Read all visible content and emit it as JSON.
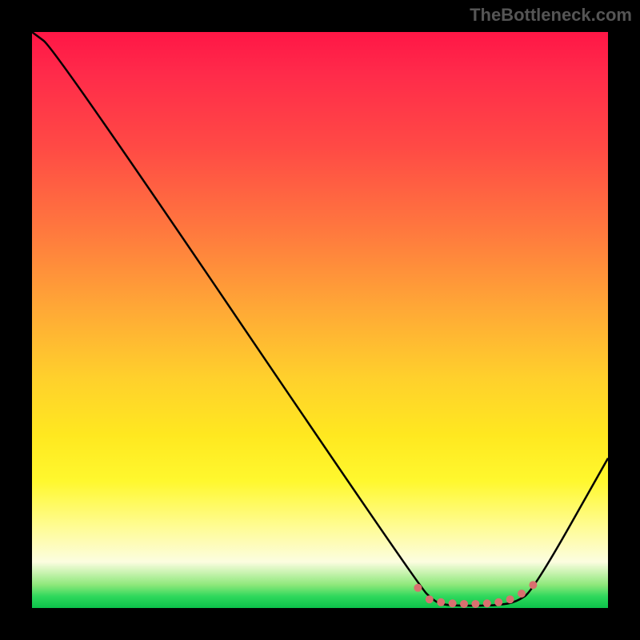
{
  "attribution": "TheBottleneck.com",
  "chart_data": {
    "type": "line",
    "title": "",
    "xlabel": "",
    "ylabel": "",
    "xlim": [
      0,
      100
    ],
    "ylim": [
      0,
      100
    ],
    "series": [
      {
        "name": "curve",
        "x": [
          0,
          4,
          67,
          70,
          72,
          75,
          78,
          81,
          84,
          87,
          100
        ],
        "values": [
          100,
          97,
          4,
          1,
          0.5,
          0.4,
          0.4,
          0.5,
          1,
          3,
          26
        ]
      }
    ],
    "markers": {
      "name": "highlight-dots",
      "color": "#d9706f",
      "x": [
        67,
        69,
        71,
        73,
        75,
        77,
        79,
        81,
        83,
        85,
        87
      ],
      "values": [
        3.5,
        1.5,
        1.0,
        0.8,
        0.7,
        0.7,
        0.8,
        1.0,
        1.5,
        2.5,
        4.0
      ]
    }
  },
  "colors": {
    "black": "#000000",
    "curve": "#000000",
    "dots": "#d9706f"
  }
}
